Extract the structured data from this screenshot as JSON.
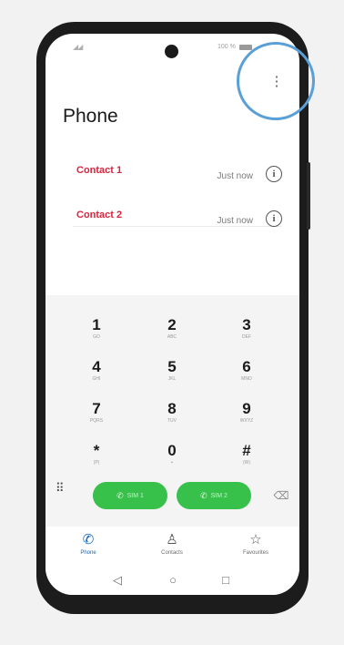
{
  "status": {
    "signal": "◢◢",
    "battery_text": "100 %"
  },
  "header": {
    "title": "Phone",
    "more_icon": "⋮"
  },
  "call_log": [
    {
      "name": "Contact 1",
      "time": "Just now",
      "info_icon": "i"
    },
    {
      "name": "Contact 2",
      "time": "Just now",
      "info_icon": "i"
    }
  ],
  "keypad": [
    {
      "digit": "1",
      "letters": "GO"
    },
    {
      "digit": "2",
      "letters": "ABC"
    },
    {
      "digit": "3",
      "letters": "DEF"
    },
    {
      "digit": "4",
      "letters": "GHI"
    },
    {
      "digit": "5",
      "letters": "JKL"
    },
    {
      "digit": "6",
      "letters": "MNO"
    },
    {
      "digit": "7",
      "letters": "PQRS"
    },
    {
      "digit": "8",
      "letters": "TUV"
    },
    {
      "digit": "9",
      "letters": "WXYZ"
    },
    {
      "digit": "*",
      "letters": "(P)"
    },
    {
      "digit": "0",
      "letters": "+"
    },
    {
      "digit": "#",
      "letters": "(W)"
    }
  ],
  "call_buttons": [
    {
      "label": "SIM 1",
      "icon": "✆"
    },
    {
      "label": "SIM 2",
      "icon": "✆"
    }
  ],
  "dialpad_toggle_icon": "⠿",
  "backspace_icon": "⌫",
  "tabs": [
    {
      "label": "Phone",
      "icon": "✆"
    },
    {
      "label": "Contacts",
      "icon": "♙"
    },
    {
      "label": "Favourites",
      "icon": "☆"
    }
  ],
  "nav": {
    "back": "◁",
    "home": "○",
    "recents": "□"
  },
  "colors": {
    "contact_name": "#d9243e",
    "call_button": "#37c04a",
    "active_tab": "#1565c0",
    "highlight": "#5a9fd6"
  }
}
